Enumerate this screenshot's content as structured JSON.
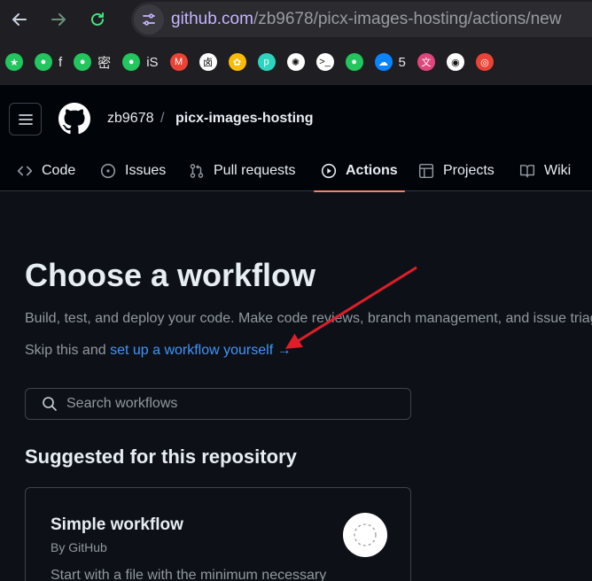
{
  "browser": {
    "url_host": "github.com",
    "url_path": "/zb9678/picx-images-hosting/actions/new",
    "bookmarks": [
      {
        "icon": "star-icon",
        "label": "",
        "color": "#22c55e"
      },
      {
        "icon": "globe-icon",
        "label": "f",
        "color": "#22c55e"
      },
      {
        "icon": "globe-icon",
        "label": "密",
        "color": "#22c55e"
      },
      {
        "icon": "globe-icon",
        "label": "iS",
        "color": "#22c55e"
      },
      {
        "icon": "gmail-icon",
        "label": "",
        "color": "#ea4335"
      },
      {
        "icon": "mask-icon",
        "label": "",
        "color": "#ffffff"
      },
      {
        "icon": "photos-icon",
        "label": "",
        "color": "#fbbc05"
      },
      {
        "icon": "p-icon",
        "label": "",
        "color": "#2dd4bf"
      },
      {
        "icon": "openai-icon",
        "label": "",
        "color": "#ffffff"
      },
      {
        "icon": "terminal-face-icon",
        "label": "",
        "color": "#ffffff"
      },
      {
        "icon": "globe-icon",
        "label": "",
        "color": "#22c55e"
      },
      {
        "icon": "onedrive-icon",
        "label": "5",
        "color": "#0a84ff"
      },
      {
        "icon": "translate-icon",
        "label": "",
        "color": "#e0457b"
      },
      {
        "icon": "github-icon",
        "label": "",
        "color": "#ffffff"
      },
      {
        "icon": "chrome-icon",
        "label": "",
        "color": "#ea4335"
      }
    ]
  },
  "header": {
    "owner": "zb9678",
    "separator": "/",
    "repo": "picx-images-hosting"
  },
  "tabs": [
    {
      "label": "Code",
      "icon": "code-icon",
      "active": false
    },
    {
      "label": "Issues",
      "icon": "issue-opened-icon",
      "active": false
    },
    {
      "label": "Pull requests",
      "icon": "git-pull-request-icon",
      "active": false
    },
    {
      "label": "Actions",
      "icon": "play-icon",
      "active": true
    },
    {
      "label": "Projects",
      "icon": "table-icon",
      "active": false
    },
    {
      "label": "Wiki",
      "icon": "book-icon",
      "active": false
    }
  ],
  "main": {
    "title": "Choose a workflow",
    "subtitle": "Build, test, and deploy your code. Make code reviews, branch management, and issue triag",
    "skip_prefix": "Skip this and",
    "skip_link": "set up a workflow yourself",
    "skip_arrow": "→",
    "search_placeholder": "Search workflows",
    "suggested_heading": "Suggested for this repository",
    "card": {
      "title": "Simple workflow",
      "by": "By GitHub",
      "desc": "Start with a file with the minimum necessary"
    }
  },
  "colors": {
    "accent_link": "#4493f8",
    "tab_underline": "#f78166",
    "annotation_arrow": "#e11d2a",
    "url_host": "#c7b5ff"
  }
}
